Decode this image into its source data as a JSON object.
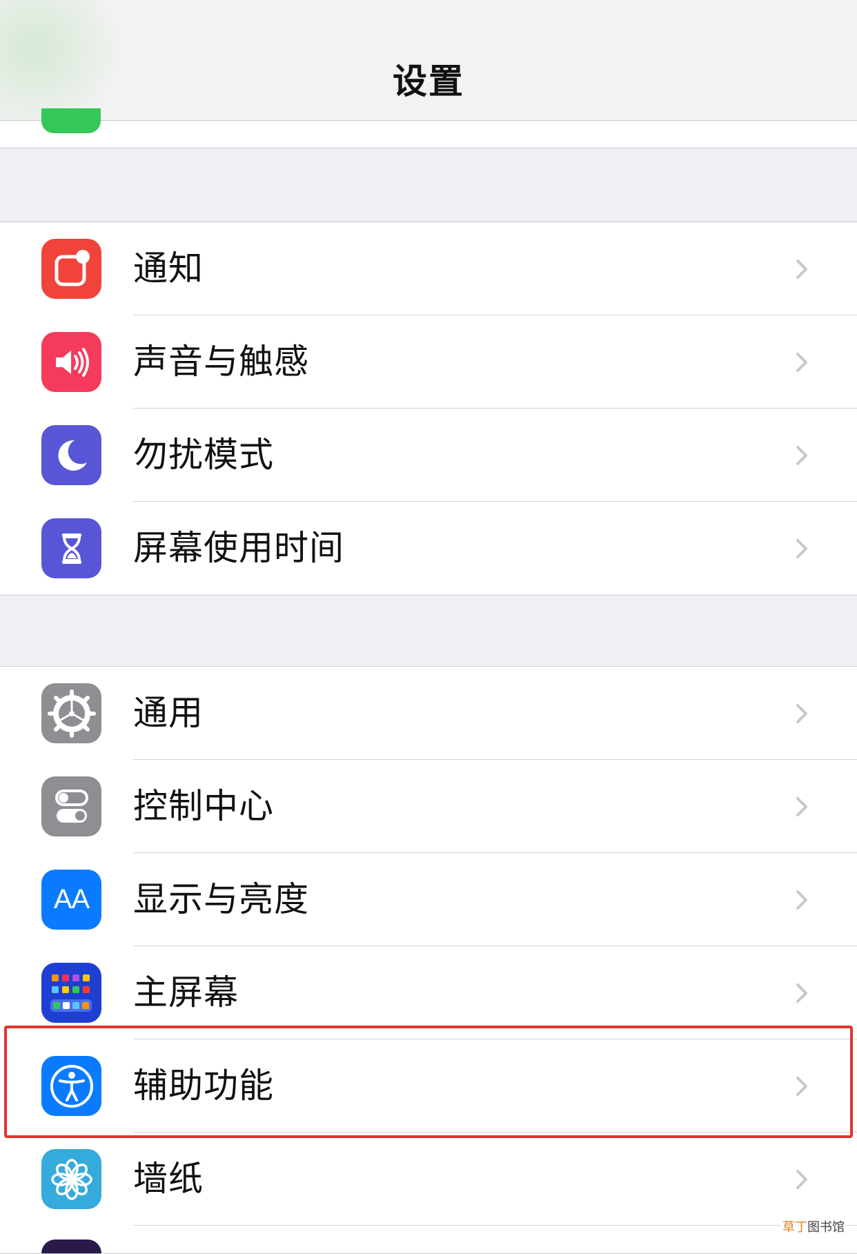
{
  "header": {
    "title": "设置"
  },
  "groups": [
    {
      "items": [
        {
          "label": "通知",
          "icon": "notifications-icon",
          "color": "#f0433a"
        },
        {
          "label": "声音与触感",
          "icon": "speaker-icon",
          "color": "#f53b5b"
        },
        {
          "label": "勿扰模式",
          "icon": "moon-icon",
          "color": "#5856d6"
        },
        {
          "label": "屏幕使用时间",
          "icon": "hourglass-icon",
          "color": "#5856d6"
        }
      ]
    },
    {
      "items": [
        {
          "label": "通用",
          "icon": "gear-icon",
          "color": "#8e8e93"
        },
        {
          "label": "控制中心",
          "icon": "toggles-icon",
          "color": "#8e8e93"
        },
        {
          "label": "显示与亮度",
          "icon": "text-size-icon",
          "color": "#0a7bff",
          "icon_text": "AA"
        },
        {
          "label": "主屏幕",
          "icon": "home-screen-grid-icon",
          "color": "#1e3fd1"
        },
        {
          "label": "辅助功能",
          "icon": "accessibility-icon",
          "color": "#0a7bff",
          "highlighted": true
        },
        {
          "label": "墙纸",
          "icon": "flower-icon",
          "color": "#35aadc"
        }
      ]
    }
  ],
  "watermark": {
    "part1": "草丁",
    "part2": "图书馆"
  }
}
